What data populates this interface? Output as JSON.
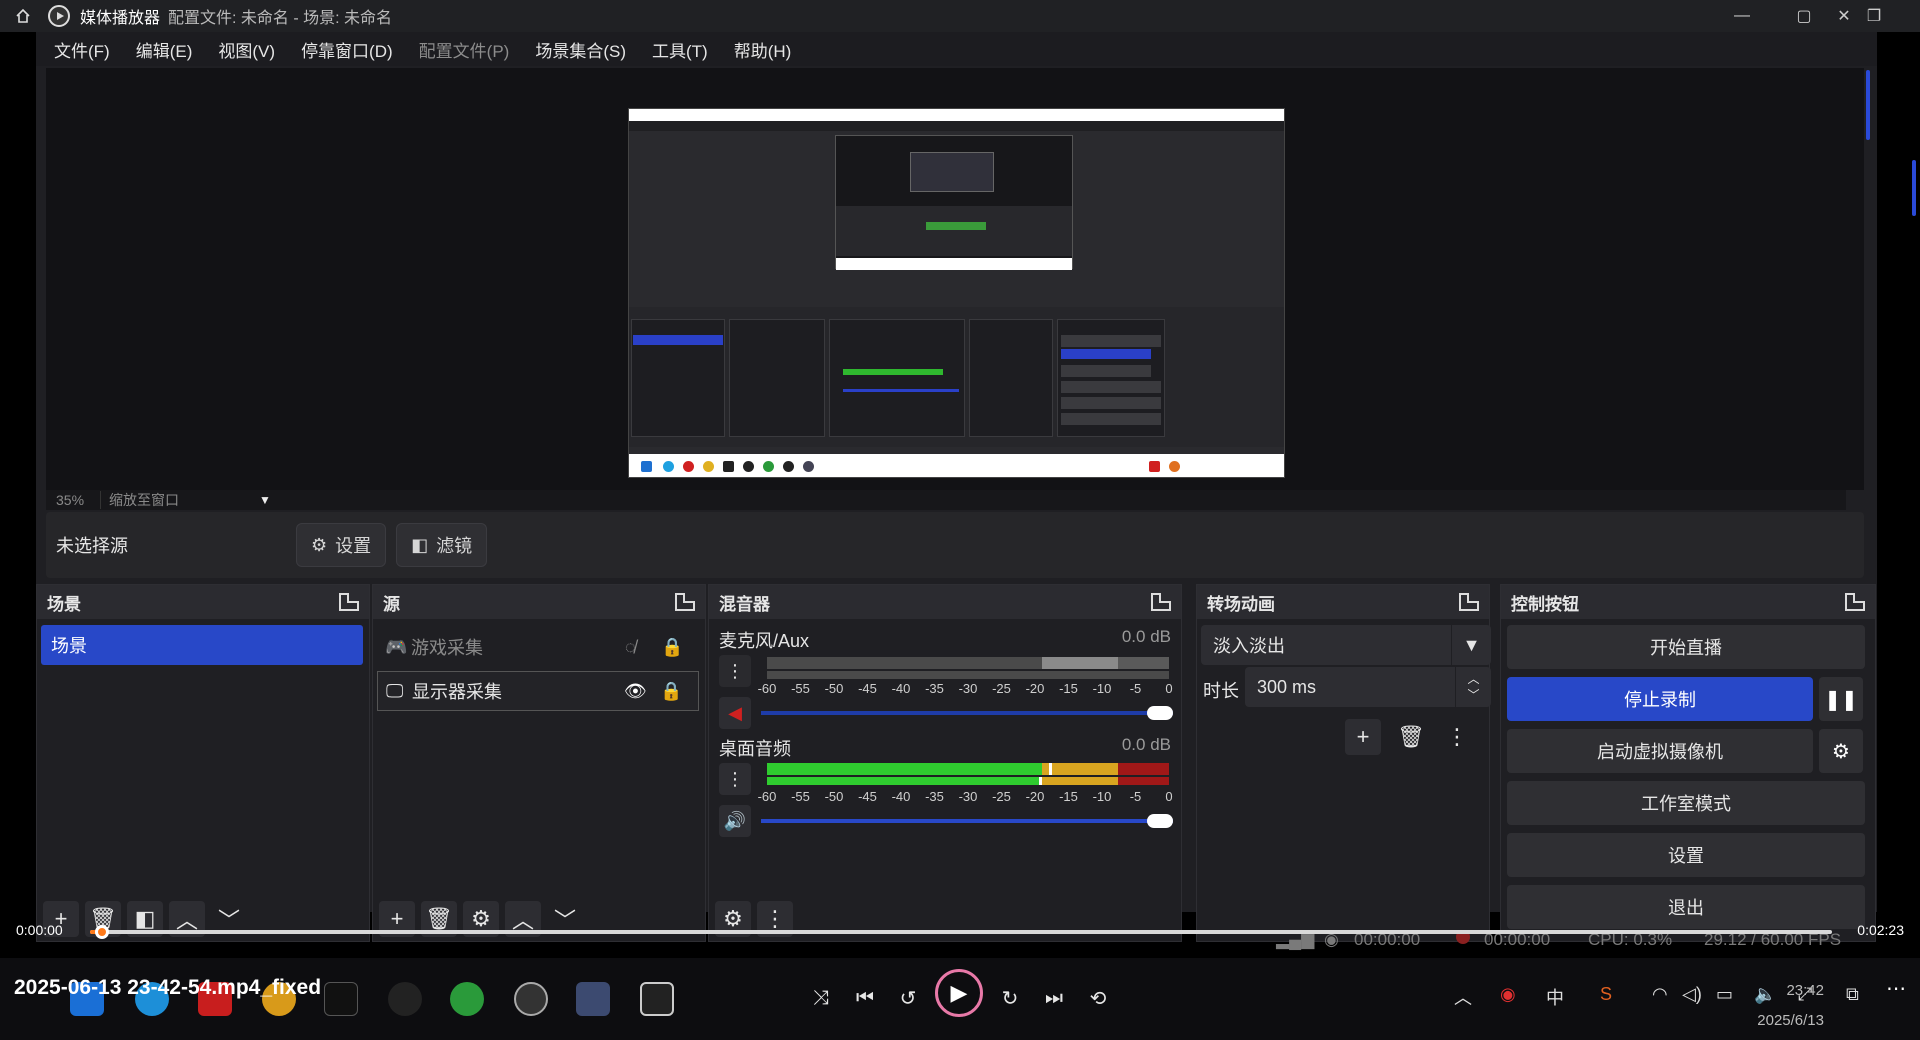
{
  "window": {
    "app_name": "媒体播放器",
    "doc_title": "配置文件: 未命名 - 场景: 未命名"
  },
  "menu": [
    {
      "label": "文件(F)",
      "disabled": false
    },
    {
      "label": "编辑(E)",
      "disabled": false
    },
    {
      "label": "视图(V)",
      "disabled": false
    },
    {
      "label": "停靠窗口(D)",
      "disabled": false
    },
    {
      "label": "配置文件(P)",
      "disabled": true
    },
    {
      "label": "场景集合(S)",
      "disabled": false
    },
    {
      "label": "工具(T)",
      "disabled": false
    },
    {
      "label": "帮助(H)",
      "disabled": false
    }
  ],
  "zoom": {
    "percent": "35%",
    "mode": "缩放至窗口"
  },
  "context_bar": {
    "no_source": "未选择源",
    "settings": "设置",
    "filters": "滤镜"
  },
  "scenes": {
    "title": "场景",
    "items": [
      "场景"
    ]
  },
  "sources": {
    "title": "源",
    "items": [
      {
        "name": "游戏采集",
        "visible": false
      },
      {
        "name": "显示器采集",
        "visible": true
      }
    ]
  },
  "mixer": {
    "title": "混音器",
    "channels": [
      {
        "name": "麦克风/Aux",
        "db": "0.0 dB",
        "muted": true,
        "level": 0.0
      },
      {
        "name": "桌面音频",
        "db": "0.0 dB",
        "muted": false,
        "level": 0.95
      }
    ],
    "ticks": [
      "-60",
      "-55",
      "-50",
      "-45",
      "-40",
      "-35",
      "-30",
      "-25",
      "-20",
      "-15",
      "-10",
      "-5",
      "0"
    ]
  },
  "transitions": {
    "title": "转场动画",
    "selected": "淡入淡出",
    "duration_label": "时长",
    "duration": "300 ms"
  },
  "controls": {
    "title": "控制按钮",
    "start_stream": "开始直播",
    "stop_record": "停止录制",
    "start_virtualcam": "启动虚拟摄像机",
    "studio_mode": "工作室模式",
    "settings": "设置",
    "exit": "退出"
  },
  "status": {
    "live_time": "00:00:00",
    "rec_time": "00:00:00",
    "cpu": "CPU: 0.3%",
    "fps": "29.12 / 60.00 FPS"
  },
  "player": {
    "current_time": "0:00:00",
    "total_time": "0:02:23",
    "progress": 0.005,
    "filename": "2025-06-13 23-42-54.mp4_fixed"
  },
  "clock": {
    "time": "23:42",
    "date": "2025/6/13"
  },
  "colors": {
    "accent": "#2848c8",
    "progress": "#ff7a1a",
    "meter_green": "#2fcc2f",
    "meter_yellow": "#d9a520",
    "meter_red": "#a01818"
  }
}
